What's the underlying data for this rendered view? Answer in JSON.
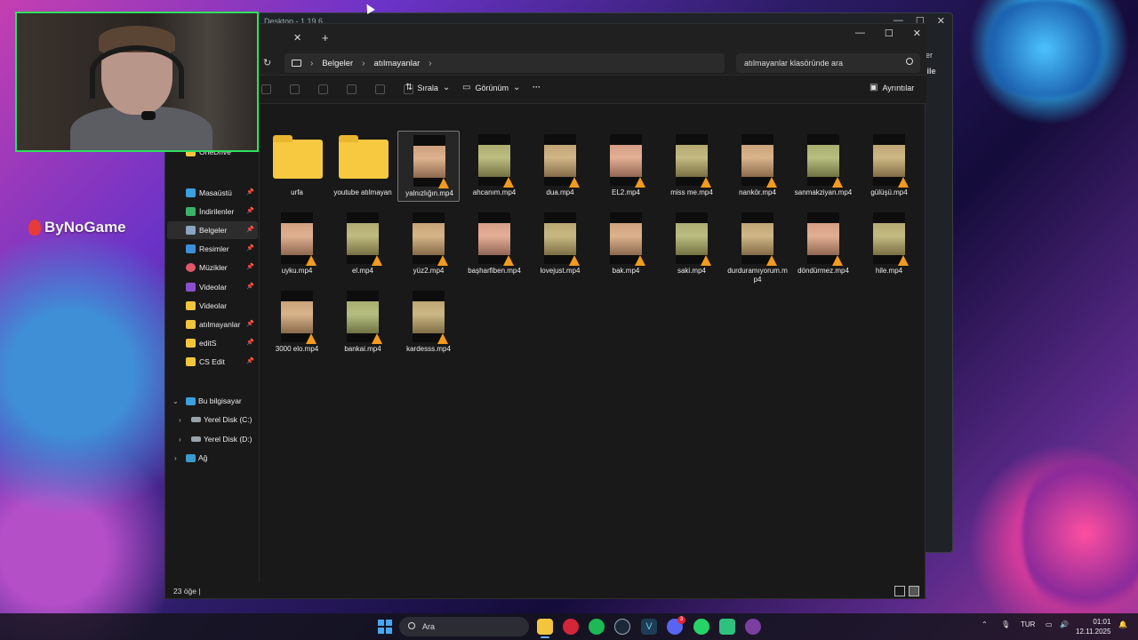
{
  "desktop": {
    "brand": "ByNoGame"
  },
  "background_window": {
    "title": "Desktop - 1.19.6",
    "side_a": "iler",
    "side_b": "nile"
  },
  "explorer": {
    "breadcrumb": [
      "Belgeler",
      "atılmayanlar"
    ],
    "search_placeholder": "atılmayanlar klasöründe ara",
    "toolbar": {
      "sort": "Sırala",
      "view": "Görünüm",
      "more": "···",
      "details": "Ayrıntılar"
    },
    "sidebar": {
      "onedrive": "OneDrive",
      "quick": [
        {
          "label": "Masaüstü",
          "icon": "desktop-icon"
        },
        {
          "label": "İndirilenler",
          "icon": "download-icon"
        },
        {
          "label": "Belgeler",
          "icon": "documents-icon"
        },
        {
          "label": "Resimler",
          "icon": "pictures-icon"
        },
        {
          "label": "Müzikler",
          "icon": "music-icon"
        },
        {
          "label": "Videolar",
          "icon": "videos-icon"
        },
        {
          "label": "Videolar",
          "icon": "folder-icon"
        },
        {
          "label": "atılmayanlar",
          "icon": "folder-icon"
        },
        {
          "label": "editS",
          "icon": "folder-icon"
        },
        {
          "label": "CS Edit",
          "icon": "folder-icon"
        }
      ],
      "this_pc": "Bu bilgisayar",
      "drives": [
        "Yerel Disk (C:)",
        "Yerel Disk (D:)"
      ],
      "network": "Ağ"
    },
    "files": [
      {
        "name": "urfa",
        "type": "folder"
      },
      {
        "name": "youtube atılmayan",
        "type": "folder"
      },
      {
        "name": "yalnızlığın.mp4",
        "type": "video"
      },
      {
        "name": "ahcanım.mp4",
        "type": "video"
      },
      {
        "name": "dua.mp4",
        "type": "video"
      },
      {
        "name": "EL2.mp4",
        "type": "video"
      },
      {
        "name": "miss me.mp4",
        "type": "video"
      },
      {
        "name": "nankör.mp4",
        "type": "video"
      },
      {
        "name": "sanmakziyan.mp4",
        "type": "video"
      },
      {
        "name": "gülüşü.mp4",
        "type": "video"
      },
      {
        "name": "uyku.mp4",
        "type": "video"
      },
      {
        "name": "el.mp4",
        "type": "video"
      },
      {
        "name": "yüz2.mp4",
        "type": "video"
      },
      {
        "name": "başharfiben.mp4",
        "type": "video"
      },
      {
        "name": "lovejust.mp4",
        "type": "video"
      },
      {
        "name": "bak.mp4",
        "type": "video"
      },
      {
        "name": "saki.mp4",
        "type": "video"
      },
      {
        "name": "durduramıyorum.mp4",
        "type": "video"
      },
      {
        "name": "döndürmez.mp4",
        "type": "video"
      },
      {
        "name": "hile.mp4",
        "type": "video"
      },
      {
        "name": "3000 elo.mp4",
        "type": "video"
      },
      {
        "name": "bankai.mp4",
        "type": "video"
      },
      {
        "name": "kardesss.mp4",
        "type": "video"
      }
    ],
    "status": "23 öğe  |"
  },
  "taskbar": {
    "search": "Ara",
    "discord_badge": "3",
    "lang": "TUR",
    "time": "01:01",
    "date": "12.11.2025"
  }
}
